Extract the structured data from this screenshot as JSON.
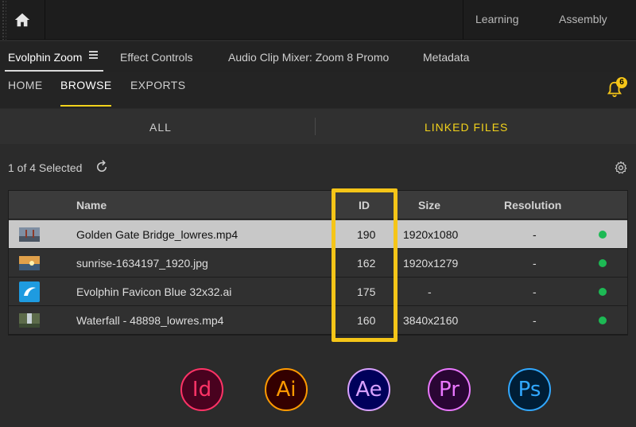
{
  "topbar": {
    "workspaces": [
      "Learning",
      "Assembly"
    ]
  },
  "panel_tabs": [
    "Evolphin Zoom",
    "Effect Controls",
    "Audio Clip Mixer: Zoom 8 Promo",
    "Metadata"
  ],
  "nav": {
    "items": [
      "HOME",
      "BROWSE",
      "EXPORTS"
    ],
    "active": "BROWSE",
    "notification_count": "6"
  },
  "filters": {
    "items": [
      "ALL",
      "LINKED FILES"
    ],
    "active": "LINKED FILES"
  },
  "selection": {
    "status": "1 of 4 Selected"
  },
  "table": {
    "columns": [
      "Name",
      "ID",
      "Size",
      "Resolution"
    ],
    "rows": [
      {
        "name": "Golden Gate Bridge_lowres.mp4",
        "id": "190",
        "size": "1920x1080",
        "resolution": "-",
        "selected": true
      },
      {
        "name": "sunrise-1634197_1920.jpg",
        "id": "162",
        "size": "1920x1279",
        "resolution": "-",
        "selected": false
      },
      {
        "name": "Evolphin Favicon Blue 32x32.ai",
        "id": "175",
        "size": "-",
        "resolution": "-",
        "selected": false
      },
      {
        "name": "Waterfall - 48898_lowres.mp4",
        "id": "160",
        "size": "3840x2160",
        "resolution": "-",
        "selected": false
      }
    ]
  },
  "apps": [
    {
      "label": "Id",
      "color": "#ff3366",
      "bg": "#49021f"
    },
    {
      "label": "Ai",
      "color": "#ff9a00",
      "bg": "#330000"
    },
    {
      "label": "Ae",
      "color": "#d8a1ff",
      "bg": "#00005b"
    },
    {
      "label": "Pr",
      "color": "#ea77ff",
      "bg": "#2a0634"
    },
    {
      "label": "Ps",
      "color": "#31a8ff",
      "bg": "#001e36"
    }
  ],
  "colors": {
    "accent": "#f2d21b",
    "highlight_box": "#f5c518",
    "status_ok": "#1db954"
  }
}
